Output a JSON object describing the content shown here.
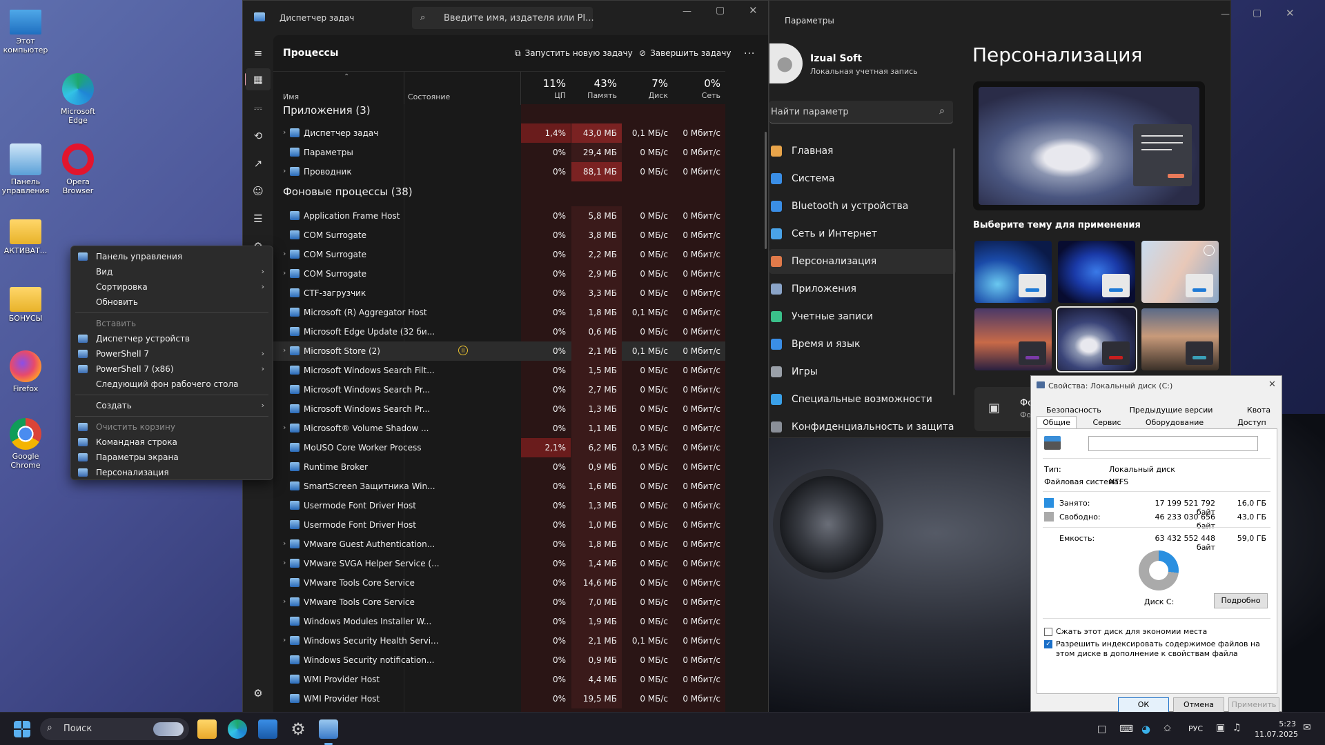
{
  "desktop": {
    "icons": [
      {
        "label": "Этот компьютер"
      },
      {
        "label": "Microsoft Edge"
      },
      {
        "label": "Панель управления"
      },
      {
        "label": "Opera Browser"
      },
      {
        "label": "АКТИВАТ..."
      },
      {
        "label": "БОНУСЫ"
      },
      {
        "label": "Firefox"
      },
      {
        "label": "Google Chrome"
      }
    ]
  },
  "context_menu": {
    "items": [
      {
        "label": "Панель управления",
        "icon": "control-panel-icon"
      },
      {
        "label": "Вид",
        "submenu": true
      },
      {
        "label": "Сортировка",
        "submenu": true
      },
      {
        "label": "Обновить"
      },
      {
        "label": "Вставить",
        "disabled": true
      },
      {
        "label": "Диспетчер устройств",
        "icon": "device-manager-icon"
      },
      {
        "label": "PowerShell 7",
        "icon": "powershell-icon",
        "submenu": true
      },
      {
        "label": "PowerShell 7 (x86)",
        "icon": "powershell-icon",
        "submenu": true
      },
      {
        "label": "Следующий фон рабочего стола"
      },
      {
        "label": "Создать",
        "submenu": true
      },
      {
        "label": "Очистить корзину",
        "icon": "recycle-bin-icon",
        "disabled": true
      },
      {
        "label": "Командная строка",
        "icon": "cmd-icon"
      },
      {
        "label": "Параметры экрана",
        "icon": "display-icon"
      },
      {
        "label": "Персонализация",
        "icon": "personalization-icon"
      }
    ]
  },
  "task_manager": {
    "title": "Диспетчер задач",
    "search_placeholder": "Введите имя, издателя или PI...",
    "page_title": "Процессы",
    "run_task": "Запустить новую задачу",
    "end_task": "Завершить задачу",
    "more": "...",
    "col_name": "Имя",
    "col_status": "Состояние",
    "cpu_pct": "11%",
    "cpu_label": "ЦП",
    "mem_pct": "43%",
    "mem_label": "Память",
    "disk_pct": "7%",
    "disk_label": "Диск",
    "net_pct": "0%",
    "net_label": "Сеть",
    "group_apps": "Приложения (3)",
    "group_bg": "Фоновые процессы (38)",
    "apps": [
      {
        "name": "Диспетчер задач",
        "cpu": "1,4%",
        "mem": "43,0 МБ",
        "disk": "0,1 МБ/с",
        "net": "0 Мбит/с",
        "expand": true
      },
      {
        "name": "Параметры",
        "cpu": "0%",
        "mem": "29,4 МБ",
        "disk": "0 МБ/с",
        "net": "0 Мбит/с",
        "expand": false
      },
      {
        "name": "Проводник",
        "cpu": "0%",
        "mem": "88,1 МБ",
        "disk": "0 МБ/с",
        "net": "0 Мбит/с",
        "expand": true
      }
    ],
    "background": [
      {
        "name": "Application Frame Host",
        "cpu": "0%",
        "mem": "5,8 МБ",
        "disk": "0 МБ/с",
        "net": "0 Мбит/с",
        "expand": false
      },
      {
        "name": "COM Surrogate",
        "cpu": "0%",
        "mem": "3,8 МБ",
        "disk": "0 МБ/с",
        "net": "0 Мбит/с",
        "expand": false
      },
      {
        "name": "COM Surrogate",
        "cpu": "0%",
        "mem": "2,2 МБ",
        "disk": "0 МБ/с",
        "net": "0 Мбит/с",
        "expand": true
      },
      {
        "name": "COM Surrogate",
        "cpu": "0%",
        "mem": "2,9 МБ",
        "disk": "0 МБ/с",
        "net": "0 Мбит/с",
        "expand": true
      },
      {
        "name": "CTF-загрузчик",
        "cpu": "0%",
        "mem": "3,3 МБ",
        "disk": "0 МБ/с",
        "net": "0 Мбит/с",
        "expand": false
      },
      {
        "name": "Microsoft (R) Aggregator Host",
        "cpu": "0%",
        "mem": "1,8 МБ",
        "disk": "0,1 МБ/с",
        "net": "0 Мбит/с",
        "expand": false
      },
      {
        "name": "Microsoft Edge Update (32 би...",
        "cpu": "0%",
        "mem": "0,6 МБ",
        "disk": "0 МБ/с",
        "net": "0 Мбит/с",
        "expand": false
      },
      {
        "name": "Microsoft Store (2)",
        "cpu": "0%",
        "mem": "2,1 МБ",
        "disk": "0,1 МБ/с",
        "net": "0 Мбит/с",
        "expand": true,
        "paused": true
      },
      {
        "name": "Microsoft Windows Search Filt...",
        "cpu": "0%",
        "mem": "1,5 МБ",
        "disk": "0 МБ/с",
        "net": "0 Мбит/с",
        "expand": false
      },
      {
        "name": "Microsoft Windows Search Pr...",
        "cpu": "0%",
        "mem": "2,7 МБ",
        "disk": "0 МБ/с",
        "net": "0 Мбит/с",
        "expand": false
      },
      {
        "name": "Microsoft Windows Search Pr...",
        "cpu": "0%",
        "mem": "1,3 МБ",
        "disk": "0 МБ/с",
        "net": "0 Мбит/с",
        "expand": false
      },
      {
        "name": "Microsoft® Volume Shadow ...",
        "cpu": "0%",
        "mem": "1,1 МБ",
        "disk": "0 МБ/с",
        "net": "0 Мбит/с",
        "expand": true
      },
      {
        "name": "MoUSO Core Worker Process",
        "cpu": "2,1%",
        "mem": "6,2 МБ",
        "disk": "0,3 МБ/с",
        "net": "0 Мбит/с",
        "expand": false
      },
      {
        "name": "Runtime Broker",
        "cpu": "0%",
        "mem": "0,9 МБ",
        "disk": "0 МБ/с",
        "net": "0 Мбит/с",
        "expand": false
      },
      {
        "name": "SmartScreen Защитника Win...",
        "cpu": "0%",
        "mem": "1,6 МБ",
        "disk": "0 МБ/с",
        "net": "0 Мбит/с",
        "expand": false
      },
      {
        "name": "Usermode Font Driver Host",
        "cpu": "0%",
        "mem": "1,3 МБ",
        "disk": "0 МБ/с",
        "net": "0 Мбит/с",
        "expand": false
      },
      {
        "name": "Usermode Font Driver Host",
        "cpu": "0%",
        "mem": "1,0 МБ",
        "disk": "0 МБ/с",
        "net": "0 Мбит/с",
        "expand": false
      },
      {
        "name": "VMware Guest Authentication...",
        "cpu": "0%",
        "mem": "1,8 МБ",
        "disk": "0 МБ/с",
        "net": "0 Мбит/с",
        "expand": true
      },
      {
        "name": "VMware SVGA Helper Service (...",
        "cpu": "0%",
        "mem": "1,4 МБ",
        "disk": "0 МБ/с",
        "net": "0 Мбит/с",
        "expand": true
      },
      {
        "name": "VMware Tools Core Service",
        "cpu": "0%",
        "mem": "14,6 МБ",
        "disk": "0 МБ/с",
        "net": "0 Мбит/с",
        "expand": false
      },
      {
        "name": "VMware Tools Core Service",
        "cpu": "0%",
        "mem": "7,0 МБ",
        "disk": "0 МБ/с",
        "net": "0 Мбит/с",
        "expand": true
      },
      {
        "name": "Windows Modules Installer W...",
        "cpu": "0%",
        "mem": "1,9 МБ",
        "disk": "0 МБ/с",
        "net": "0 Мбит/с",
        "expand": false
      },
      {
        "name": "Windows Security Health Servi...",
        "cpu": "0%",
        "mem": "2,1 МБ",
        "disk": "0,1 МБ/с",
        "net": "0 Мбит/с",
        "expand": true
      },
      {
        "name": "Windows Security notification...",
        "cpu": "0%",
        "mem": "0,9 МБ",
        "disk": "0 МБ/с",
        "net": "0 Мбит/с",
        "expand": false
      },
      {
        "name": "WMI Provider Host",
        "cpu": "0%",
        "mem": "4,4 МБ",
        "disk": "0 МБ/с",
        "net": "0 Мбит/с",
        "expand": false
      },
      {
        "name": "WMI Provider Host",
        "cpu": "0%",
        "mem": "19,5 МБ",
        "disk": "0 МБ/с",
        "net": "0 Мбит/с",
        "expand": false
      }
    ]
  },
  "settings": {
    "title": "Параметры",
    "user_name": "Izual Soft",
    "user_sub": "Локальная учетная запись",
    "search_placeholder": "Найти параметр",
    "page_title": "Персонализация",
    "theme_heading": "Выберите тему для применения",
    "nav": [
      {
        "label": "Главная",
        "icon": "home-icon",
        "color": "#e8a44a"
      },
      {
        "label": "Система",
        "icon": "system-icon",
        "color": "#3a8ee6"
      },
      {
        "label": "Bluetooth и устройства",
        "icon": "bluetooth-icon",
        "color": "#3a8ee6"
      },
      {
        "label": "Сеть и Интернет",
        "icon": "network-icon",
        "color": "#4aa3e8"
      },
      {
        "label": "Персонализация",
        "icon": "brush-icon",
        "color": "#e07a4a",
        "selected": true
      },
      {
        "label": "Приложения",
        "icon": "apps-icon",
        "color": "#8aa4c8"
      },
      {
        "label": "Учетные записи",
        "icon": "accounts-icon",
        "color": "#3ac08a"
      },
      {
        "label": "Время и язык",
        "icon": "time-language-icon",
        "color": "#3a8ee6"
      },
      {
        "label": "Игры",
        "icon": "games-icon",
        "color": "#9aa0a8"
      },
      {
        "label": "Специальные возможности",
        "icon": "accessibility-icon",
        "color": "#3aa0e8"
      },
      {
        "label": "Конфиденциальность и защита",
        "icon": "privacy-shield-icon",
        "color": "#8a8f98"
      }
    ],
    "bg_item_label": "Фон",
    "bg_item_sub": "Фон",
    "themes": [
      {
        "bar": "#1e7ad6"
      },
      {
        "bar": "#1e7ad6"
      },
      {
        "bar": "#1e7ad6"
      },
      {
        "bar": "#7a3aa8"
      },
      {
        "bar": "#c81e1e"
      },
      {
        "bar": "#3aa0b8"
      }
    ]
  },
  "properties": {
    "title": "Свойства: Локальный диск (C:)",
    "tabs_row1": [
      "Безопасность",
      "Предыдущие версии",
      "Квота"
    ],
    "tabs_row2": [
      "Общие",
      "Сервис",
      "Оборудование",
      "Доступ"
    ],
    "type_label": "Тип:",
    "type_value": "Локальный диск",
    "fs_label": "Файловая система:",
    "fs_value": "NTFS",
    "used_label": "Занято:",
    "used_bytes": "17 199 521 792 байт",
    "used_gb": "16,0 ГБ",
    "free_label": "Свободно:",
    "free_bytes": "46 233 030 656 байт",
    "free_gb": "43,0 ГБ",
    "cap_label": "Емкость:",
    "cap_bytes": "63 432 552 448 байт",
    "cap_gb": "59,0 ГБ",
    "used_fraction": 0.27,
    "disk_label": "Диск C:",
    "details_btn": "Подробно",
    "compress": "Сжать этот диск для экономии места",
    "index": "Разрешить индексировать содержимое файлов на этом диске в дополнение к свойствам файла",
    "ok": "ОК",
    "cancel": "Отмена",
    "apply": "Применить"
  },
  "taskbar": {
    "search": "Поиск",
    "lang": "РУС",
    "time": "5:23",
    "date": "11.07.2025"
  }
}
